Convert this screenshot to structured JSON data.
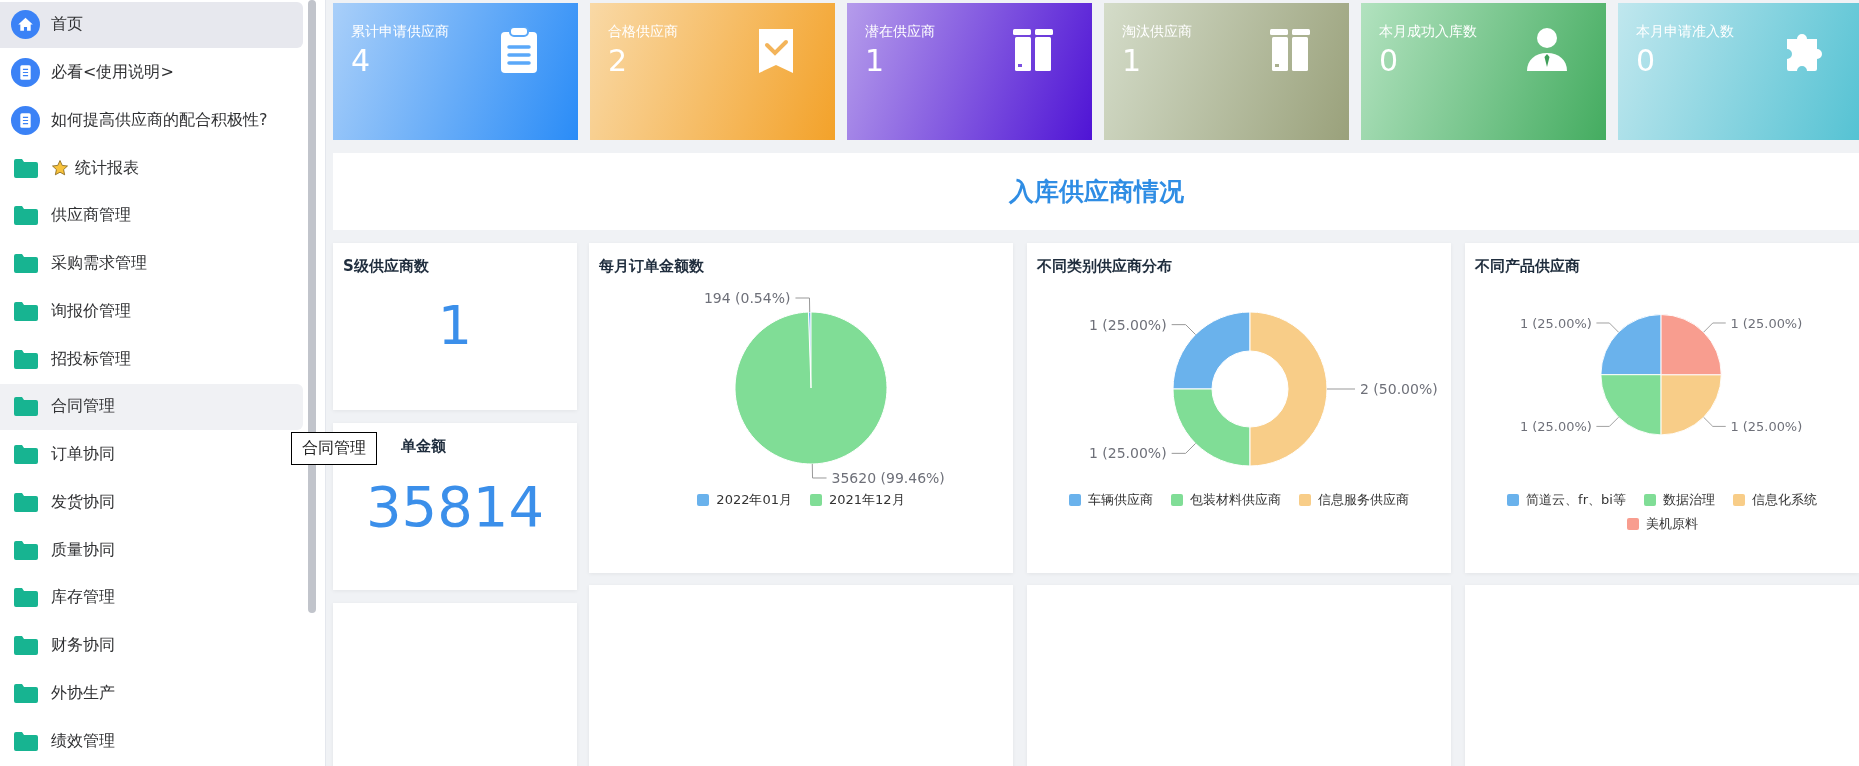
{
  "sidebar": {
    "items": [
      {
        "label": "首页",
        "kind": "home",
        "selected": true,
        "hovered": false,
        "starred": false
      },
      {
        "label": "必看<使用说明>",
        "kind": "doc",
        "selected": false,
        "hovered": false,
        "starred": false
      },
      {
        "label": "如何提高供应商的配合积极性?",
        "kind": "doc",
        "selected": false,
        "hovered": false,
        "starred": false
      },
      {
        "label": "统计报表",
        "kind": "folder",
        "selected": false,
        "hovered": false,
        "starred": true
      },
      {
        "label": "供应商管理",
        "kind": "folder",
        "selected": false,
        "hovered": false,
        "starred": false
      },
      {
        "label": "采购需求管理",
        "kind": "folder",
        "selected": false,
        "hovered": false,
        "starred": false
      },
      {
        "label": "询报价管理",
        "kind": "folder",
        "selected": false,
        "hovered": false,
        "starred": false
      },
      {
        "label": "招投标管理",
        "kind": "folder",
        "selected": false,
        "hovered": false,
        "starred": false
      },
      {
        "label": "合同管理",
        "kind": "folder",
        "selected": false,
        "hovered": true,
        "starred": false
      },
      {
        "label": "订单协同",
        "kind": "folder",
        "selected": false,
        "hovered": false,
        "starred": false
      },
      {
        "label": "发货协同",
        "kind": "folder",
        "selected": false,
        "hovered": false,
        "starred": false
      },
      {
        "label": "质量协同",
        "kind": "folder",
        "selected": false,
        "hovered": false,
        "starred": false
      },
      {
        "label": "库存管理",
        "kind": "folder",
        "selected": false,
        "hovered": false,
        "starred": false
      },
      {
        "label": "财务协同",
        "kind": "folder",
        "selected": false,
        "hovered": false,
        "starred": false
      },
      {
        "label": "外协生产",
        "kind": "folder",
        "selected": false,
        "hovered": false,
        "starred": false
      },
      {
        "label": "绩效管理",
        "kind": "folder",
        "selected": false,
        "hovered": false,
        "starred": false
      }
    ]
  },
  "tooltip": {
    "text": "合同管理"
  },
  "stats": [
    {
      "label": "累计申请供应商",
      "value": "4"
    },
    {
      "label": "合格供应商",
      "value": "2"
    },
    {
      "label": "潜在供应商",
      "value": "1"
    },
    {
      "label": "淘汰供应商",
      "value": "1"
    },
    {
      "label": "本月成功入库数",
      "value": "0"
    },
    {
      "label": "本月申请准入数",
      "value": "0"
    }
  ],
  "banner": {
    "title": "入库供应商情况"
  },
  "metrics": [
    {
      "title": "S级供应商数",
      "value": "1"
    },
    {
      "title": "单金额",
      "value": "35814"
    }
  ],
  "charts": [
    {
      "title": "每月订单金额数",
      "chart_data": {
        "type": "pie",
        "categories": [
          "2022年01月",
          "2021年12月"
        ],
        "colors": [
          "#6ab2ec",
          "#80dd96"
        ],
        "values": [
          194,
          35620
        ],
        "legend": "bottom",
        "value_labels": [
          "194 (0.54%)",
          "35620 (99.46%)"
        ]
      }
    },
    {
      "title": "不同类别供应商分布",
      "chart_data": {
        "type": "donut",
        "categories": [
          "车辆供应商",
          "包装材料供应商",
          "信息服务供应商"
        ],
        "colors": [
          "#6ab2ec",
          "#80dd96",
          "#f8cd88"
        ],
        "values": [
          1,
          1,
          2
        ],
        "legend": "bottom",
        "value_labels": [
          "1 (25.00%)",
          "1 (25.00%)",
          "2 (50.00%)"
        ]
      }
    },
    {
      "title": "不同产品供应商",
      "chart_data": {
        "type": "pie",
        "categories": [
          "简道云、fr、bi等",
          "数据治理",
          "信息化系统",
          "美机原料"
        ],
        "colors": [
          "#6ab2ec",
          "#80dd96",
          "#f8cd88",
          "#f89d8f"
        ],
        "values": [
          1,
          1,
          1,
          1
        ],
        "legend": "bottom",
        "value_labels": [
          "1 (25.00%)",
          "1 (25.00%)",
          "1 (25.00%)",
          "1 (25.00%)"
        ]
      }
    }
  ]
}
